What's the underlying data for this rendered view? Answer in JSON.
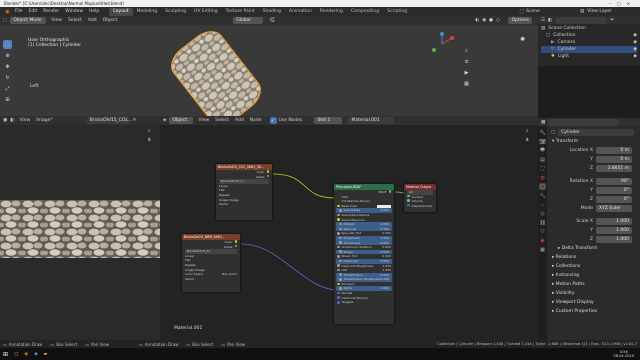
{
  "title_bar": {
    "text": "Blender* [C:\\Users\\dec\\Desktop\\Normal Map\\untitled.blend]"
  },
  "menu": {
    "items": [
      "File",
      "Edit",
      "Render",
      "Window",
      "Help"
    ]
  },
  "workspace_tabs": [
    "Layout",
    "Modeling",
    "Sculpting",
    "UV Editing",
    "Texture Paint",
    "Shading",
    "Animation",
    "Rendering",
    "Compositing",
    "Scripting"
  ],
  "active_tab": "Layout",
  "scene": {
    "label": "Scene",
    "view_layer": "View Layer"
  },
  "viewport": {
    "mode": "Object Mode",
    "menu": [
      "View",
      "Select",
      "Add",
      "Object"
    ],
    "transform": "Global",
    "options": "Options",
    "info_line1": "User Orthographic",
    "info_line2": "(1) Collection | Cylinder",
    "side_label": "Left"
  },
  "outliner": {
    "header": "Scene Collection",
    "items": [
      {
        "label": "Collection"
      },
      {
        "label": "Camera"
      },
      {
        "label": "Cylinder"
      },
      {
        "label": "Light"
      }
    ]
  },
  "image_editor": {
    "menu": [
      "View",
      "Image*"
    ],
    "image_name": "BricksOld15_COL..."
  },
  "node_editor": {
    "mode": "Object",
    "menu": [
      "View",
      "Select",
      "Add",
      "Node"
    ],
    "use_nodes_label": "Use Nodes",
    "slot": "Slot 1",
    "material": "Material.001",
    "footer_material": "Material.001"
  },
  "nodes": {
    "img1": {
      "title": "BricksOld15_COL_VAR1_3K...",
      "out_color": "Color",
      "out_alpha": "Alpha",
      "name": "BricksOld15_C...",
      "linear": "Linear",
      "flat": "Flat",
      "repeat": "Repeat",
      "single": "Single Image",
      "vector": "Vector"
    },
    "img2": {
      "title": "BricksOld15_NRM_VAR1...",
      "out_color": "Color",
      "out_alpha": "Alpha",
      "name": "BricksOld15_N...",
      "linear": "Linear",
      "flat": "Flat",
      "repeat": "Repeat",
      "single": "Single Image",
      "colorspace_label": "Color Space",
      "colorspace": "Non-Color",
      "vector": "Vector"
    },
    "bsdf": {
      "title": "Principled BSDF",
      "out": "BSDF",
      "rows": [
        {
          "label": "GGX",
          "value": ""
        },
        {
          "label": "Christensen-Burley",
          "value": ""
        },
        {
          "label": "Base Color",
          "value": ""
        },
        {
          "label": "Subsurface",
          "value": "0.000"
        },
        {
          "label": "Subsurface Radius",
          "value": ""
        },
        {
          "label": "Subsurface Col...",
          "value": ""
        },
        {
          "label": "Metallic",
          "value": "0.000"
        },
        {
          "label": "Specular",
          "value": "0.500"
        },
        {
          "label": "Specular Tint",
          "value": "0.000"
        },
        {
          "label": "Roughness",
          "value": "0.500"
        },
        {
          "label": "Anisotropic",
          "value": "0.000"
        },
        {
          "label": "Anisotropic Rotation",
          "value": "0.000"
        },
        {
          "label": "Sheen",
          "value": "0.000"
        },
        {
          "label": "Sheen Tint",
          "value": "0.500"
        },
        {
          "label": "Clearcoat",
          "value": "0.000"
        },
        {
          "label": "Clearcoat Roughness",
          "value": "0.030"
        },
        {
          "label": "IOR",
          "value": "1.450"
        },
        {
          "label": "Transmission",
          "value": "0.000"
        },
        {
          "label": "Transmission Roughness",
          "value": "0.000"
        },
        {
          "label": "Emission",
          "value": ""
        },
        {
          "label": "Alpha",
          "value": "1.000"
        },
        {
          "label": "Normal",
          "value": ""
        },
        {
          "label": "Clearcoat Normal",
          "value": ""
        },
        {
          "label": "Tangent",
          "value": ""
        }
      ]
    },
    "output": {
      "title": "Material Output",
      "target": "All",
      "rows": [
        "Surface",
        "Volume",
        "Displacement"
      ]
    }
  },
  "properties": {
    "object": "Cylinder",
    "section": "Transform",
    "location": [
      {
        "label": "Location X",
        "value": "0 m"
      },
      {
        "label": "Y",
        "value": "0 m"
      },
      {
        "label": "Z",
        "value": "3.8651 m"
      }
    ],
    "rotation": [
      {
        "label": "Rotation X",
        "value": "90°"
      },
      {
        "label": "Y",
        "value": "0°"
      },
      {
        "label": "Z",
        "value": "0°"
      }
    ],
    "mode_label": "Mode",
    "mode": "XYZ Euler",
    "scale": [
      {
        "label": "Scale X",
        "value": "1.000"
      },
      {
        "label": "Y",
        "value": "1.000"
      },
      {
        "label": "Z",
        "value": "1.000"
      }
    ],
    "collapsed": [
      "Delta Transform",
      "Relations",
      "Collections",
      "Instancing",
      "Motion Paths",
      "Visibility",
      "Viewport Display",
      "Custom Properties"
    ]
  },
  "status_bar": {
    "left": [
      "Annotation Draw",
      "Box Select",
      "Pan View",
      "Annotation Draw",
      "Box Select",
      "Pan View"
    ],
    "right": "Collection | Cylinder | Вершин 1,408 | Граней 1,344 | Треуг. 2,688 | Объектов 1/3 | Пам.: 513.1 MiB | v2.82.7"
  },
  "clock": {
    "time": "3:56",
    "date": "08.04.2020"
  }
}
